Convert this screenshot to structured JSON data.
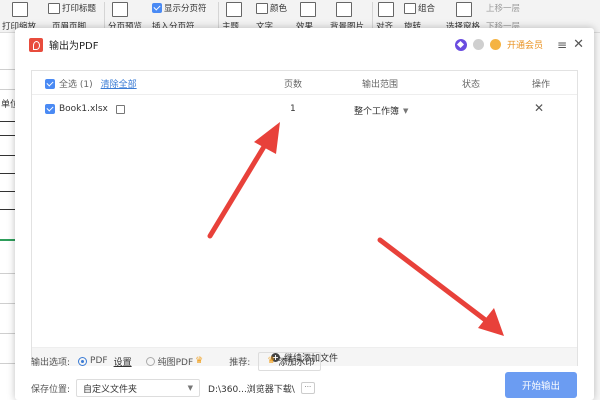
{
  "ribbon": {
    "items": [
      "打印标题",
      "显示分页符",
      "颜色",
      "组合",
      "上移一层",
      "页眉页脚",
      "分页预览",
      "插入分页符",
      "主题",
      "文字",
      "效果",
      "背景图片",
      "对齐",
      "旋转",
      "选择窗格",
      "下移一层",
      "打印缩放"
    ]
  },
  "sheet": {
    "cell_text": "单位"
  },
  "dialog": {
    "title": "输出为PDF",
    "vip_label": "开通会员",
    "columns": {
      "select_all": "全选 (1)",
      "clear_all": "清除全部",
      "pages": "页数",
      "range": "输出范围",
      "status": "状态",
      "action": "操作"
    },
    "files": [
      {
        "name": "Book1.xlsx",
        "pages": "1",
        "range": "整个工作簿",
        "status": ""
      }
    ],
    "add_files": "继续添加文件",
    "options": {
      "label": "输出选项:",
      "pdf": "PDF",
      "settings": "设置",
      "image_pdf": "纯图PDF",
      "recommend": "推荐:",
      "watermark": "添加水印"
    },
    "save": {
      "label": "保存位置:",
      "location": "自定义文件夹",
      "path": "D:\\360...浏览器下载\\",
      "more": "···"
    },
    "start_button": "开始输出"
  },
  "colors": {
    "accent": "#4a8af4",
    "start_button": "#6b9cf2",
    "vip": "#e9911f",
    "arrow": "#e8413a",
    "pdf_logo": "#e84c3d"
  }
}
